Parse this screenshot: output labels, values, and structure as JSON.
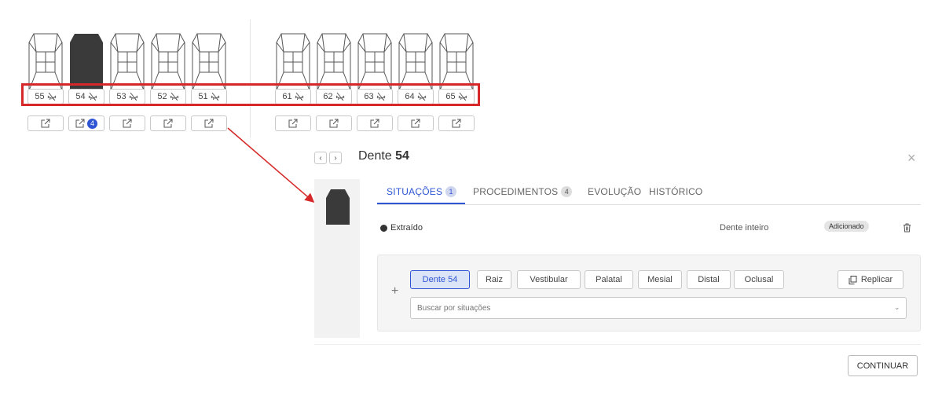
{
  "teeth_upper_left": [
    {
      "number": "55",
      "filled": false,
      "badge": ""
    },
    {
      "number": "54",
      "filled": true,
      "badge": "4"
    },
    {
      "number": "53",
      "filled": false,
      "badge": ""
    },
    {
      "number": "52",
      "filled": false,
      "badge": ""
    },
    {
      "number": "51",
      "filled": false,
      "badge": ""
    }
  ],
  "teeth_upper_right": [
    {
      "number": "61",
      "filled": false,
      "badge": ""
    },
    {
      "number": "62",
      "filled": false,
      "badge": ""
    },
    {
      "number": "63",
      "filled": false,
      "badge": ""
    },
    {
      "number": "64",
      "filled": false,
      "badge": ""
    },
    {
      "number": "65",
      "filled": false,
      "badge": ""
    }
  ],
  "modal": {
    "prev_icon": "‹",
    "next_icon": "›",
    "title_prefix": "Dente ",
    "title_number": "54",
    "close_icon": "×",
    "tabs": [
      {
        "label": "SITUAÇÕES",
        "count": "1",
        "active": true
      },
      {
        "label": "PROCEDIMENTOS",
        "count": "4",
        "active": false
      },
      {
        "label": "EVOLUÇÃO",
        "count": "",
        "active": false
      },
      {
        "label": "HISTÓRICO",
        "count": "",
        "active": false
      }
    ],
    "situation": {
      "name": "Extraído",
      "scope": "Dente inteiro",
      "status": "Adicionado"
    },
    "editor": {
      "plus": "+",
      "chips": [
        "Dente 54",
        "Raiz",
        "Vestibular",
        "Palatal",
        "Mesial",
        "Distal",
        "Oclusal"
      ],
      "replicate_label": "Replicar",
      "search_placeholder": "Buscar por situações",
      "chevron": "⌄"
    },
    "continue_label": "CONTINUAR"
  },
  "colors": {
    "accent": "#2f55d4",
    "highlight_box": "#d62828",
    "tooth_filled": "#3a3a3a"
  }
}
